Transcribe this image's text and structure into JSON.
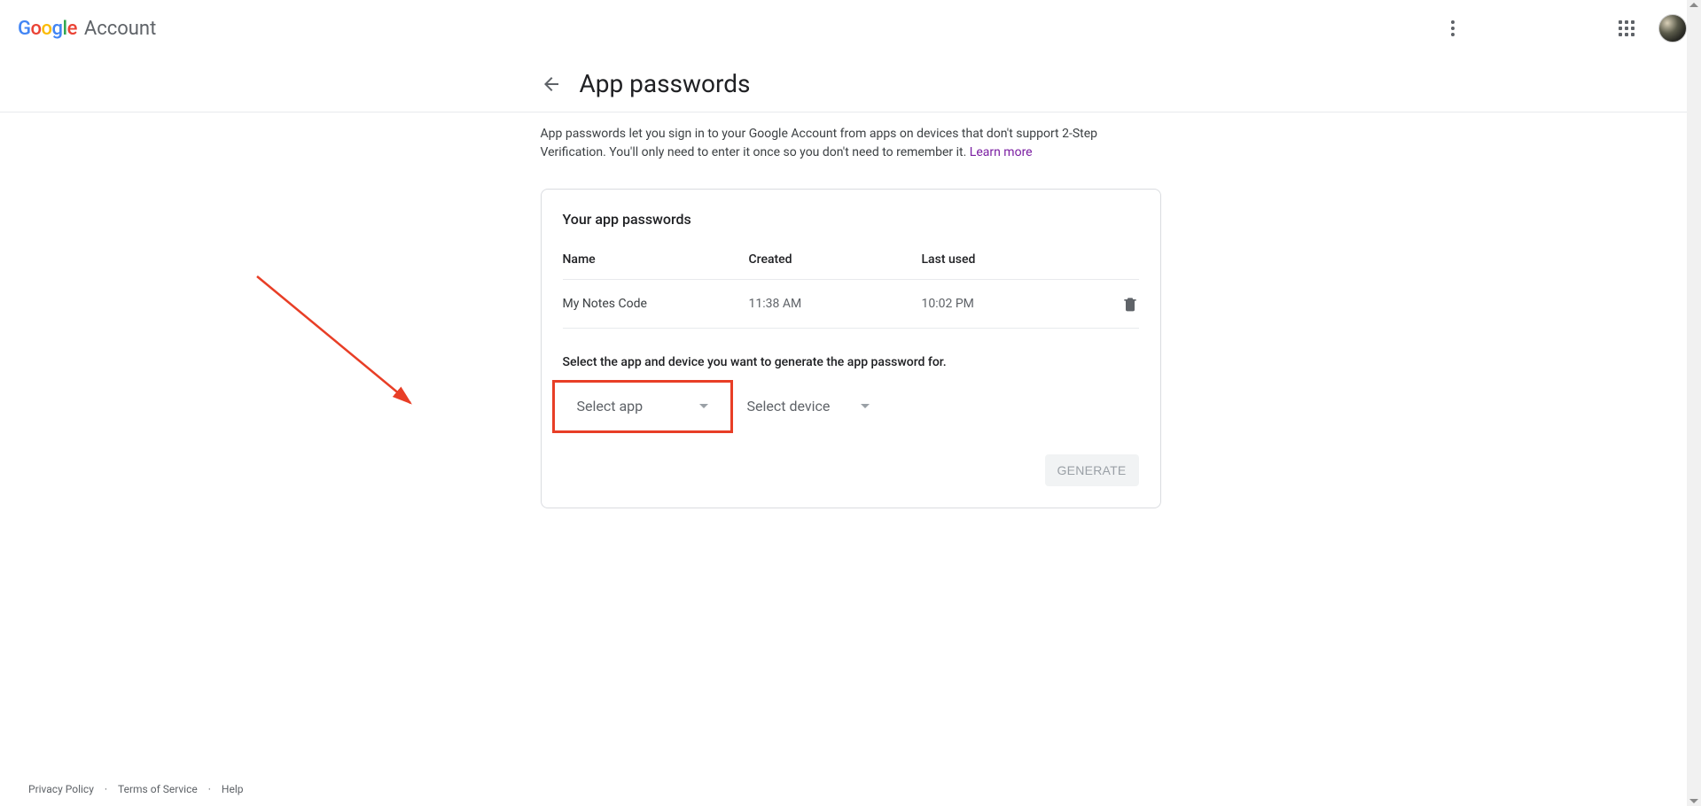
{
  "header": {
    "logo_text": "Google",
    "product": "Account"
  },
  "page": {
    "title": "App passwords",
    "description_pre": "App passwords let you sign in to your Google Account from apps on devices that don't support 2-Step Verification. You'll only need to enter it once so you don't need to remember it. ",
    "learn_more": "Learn more"
  },
  "card": {
    "title": "Your app passwords",
    "columns": {
      "name": "Name",
      "created": "Created",
      "last_used": "Last used"
    },
    "rows": [
      {
        "name": "My Notes Code",
        "created": "11:38 AM",
        "last_used": "10:02 PM"
      }
    ],
    "instruction": "Select the app and device you want to generate the app password for.",
    "select_app": "Select app",
    "select_device": "Select device",
    "generate": "GENERATE"
  },
  "footer": {
    "privacy": "Privacy Policy",
    "terms": "Terms of Service",
    "help": "Help"
  }
}
